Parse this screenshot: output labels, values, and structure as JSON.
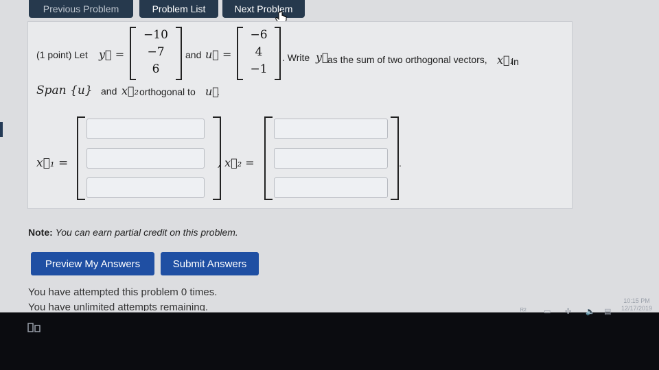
{
  "nav": {
    "previous": "Previous Problem",
    "problem_list": "Problem List",
    "next": "Next Problem"
  },
  "problem": {
    "points": "(1 point) Let",
    "y_label": "y⃗ =",
    "and": "and",
    "u_label": "u⃗ =",
    "y_vector": [
      "−10",
      "−7",
      "6"
    ],
    "u_vector": [
      "−6",
      "4",
      "−1"
    ],
    "instruction_a": ". Write",
    "instruction_b": "as the sum of two orthogonal vectors,",
    "instruction_c": "in",
    "y_sym": "y⃗",
    "x1_sym": "x⃗₁",
    "span_text": "Span {u}",
    "and2": "and",
    "x2_sym": "x⃗₂",
    "orth_text": "orthogonal to",
    "u_sym": "u⃗",
    "period": ".",
    "x1_answer_label": "x⃗₁ =",
    "x2_answer_label": ", x⃗₂ =",
    "end_period": "."
  },
  "note": {
    "label": "Note:",
    "text": "You can earn partial credit on this problem."
  },
  "actions": {
    "preview": "Preview My Answers",
    "submit": "Submit Answers"
  },
  "attempts": {
    "line1": "You have attempted this problem 0 times.",
    "line2": "You have unlimited attempts remaining."
  },
  "system": {
    "time": "10:15 PM",
    "date": "12/17/2019"
  }
}
